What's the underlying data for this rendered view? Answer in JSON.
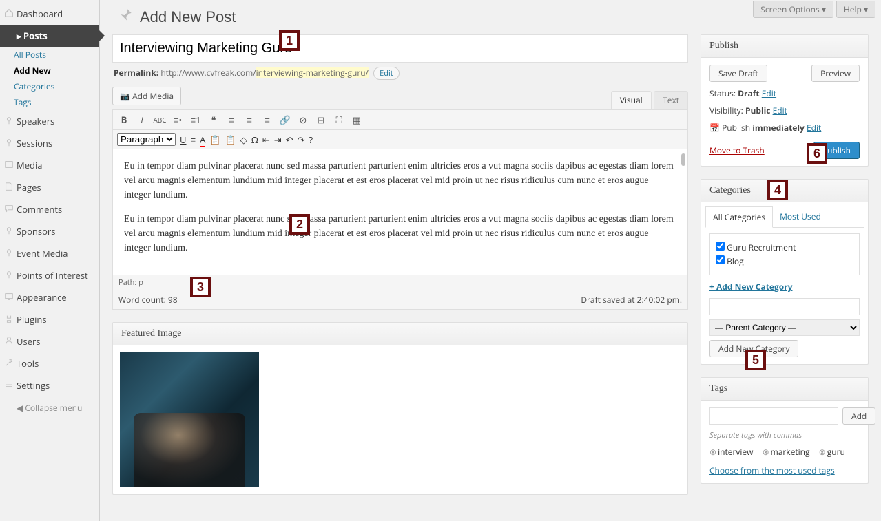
{
  "top": {
    "screen_options": "Screen Options ▾",
    "help": "Help ▾"
  },
  "menu": {
    "dashboard": "Dashboard",
    "posts": "Posts",
    "posts_sub": {
      "all": "All Posts",
      "add": "Add New",
      "categories": "Categories",
      "tags": "Tags"
    },
    "speakers": "Speakers",
    "sessions": "Sessions",
    "media": "Media",
    "pages": "Pages",
    "comments": "Comments",
    "sponsors": "Sponsors",
    "event_media": "Event Media",
    "poi": "Points of Interest",
    "appearance": "Appearance",
    "plugins": "Plugins",
    "users": "Users",
    "tools": "Tools",
    "settings": "Settings",
    "collapse": "Collapse menu"
  },
  "page_title": "Add New Post",
  "title_value": "Interviewing Marketing Guru",
  "permalink": {
    "label": "Permalink:",
    "base": "http://www.cvfreak.com/",
    "slug": "interviewing-marketing-guru/",
    "edit": "Edit"
  },
  "media_btn": "Add Media",
  "editor": {
    "visual": "Visual",
    "text": "Text",
    "paragraph": "Paragraph",
    "para1": "Eu in tempor diam pulvinar placerat nunc sed massa parturient parturient enim ultricies eros a vut magna sociis dapibus ac egestas diam lorem vel arcu magnis elementum lundium mid integer placerat et est eros placerat vel mid proin ut nec risus ridiculus cum nunc et eros augue integer lundium.",
    "para2": "Eu in tempor diam pulvinar placerat nunc sed massa parturient parturient enim ultricies eros a vut magna sociis dapibus ac egestas diam lorem vel arcu magnis elementum lundium mid integer placerat et est eros placerat vel mid proin ut nec risus ridiculus cum nunc et eros augue integer lundium.",
    "path": "Path: p",
    "word_count": "Word count: 98",
    "draft_msg": "Draft saved at 2:40:02 pm."
  },
  "featured": {
    "heading": "Featured Image"
  },
  "publish": {
    "heading": "Publish",
    "save_draft": "Save Draft",
    "preview": "Preview",
    "status_label": "Status:",
    "status_val": "Draft",
    "edit": "Edit",
    "visibility_label": "Visibility:",
    "visibility_val": "Public",
    "schedule_label": "Publish",
    "schedule_val": "immediately",
    "trash": "Move to Trash",
    "publish_btn": "Publish"
  },
  "categories": {
    "heading": "Categories",
    "tab_all": "All Categories",
    "tab_most": "Most Used",
    "items": [
      "Guru Recruitment",
      "Blog"
    ],
    "add_link": "+ Add New Category",
    "parent_placeholder": "— Parent Category —",
    "add_btn": "Add New Category"
  },
  "tags": {
    "heading": "Tags",
    "add_btn": "Add",
    "hint": "Separate tags with commas",
    "chips": [
      "interview",
      "marketing",
      "guru"
    ],
    "choose": "Choose from the most used tags"
  },
  "badges": {
    "1": "1",
    "2": "2",
    "3": "3",
    "4": "4",
    "5": "5",
    "6": "6"
  }
}
